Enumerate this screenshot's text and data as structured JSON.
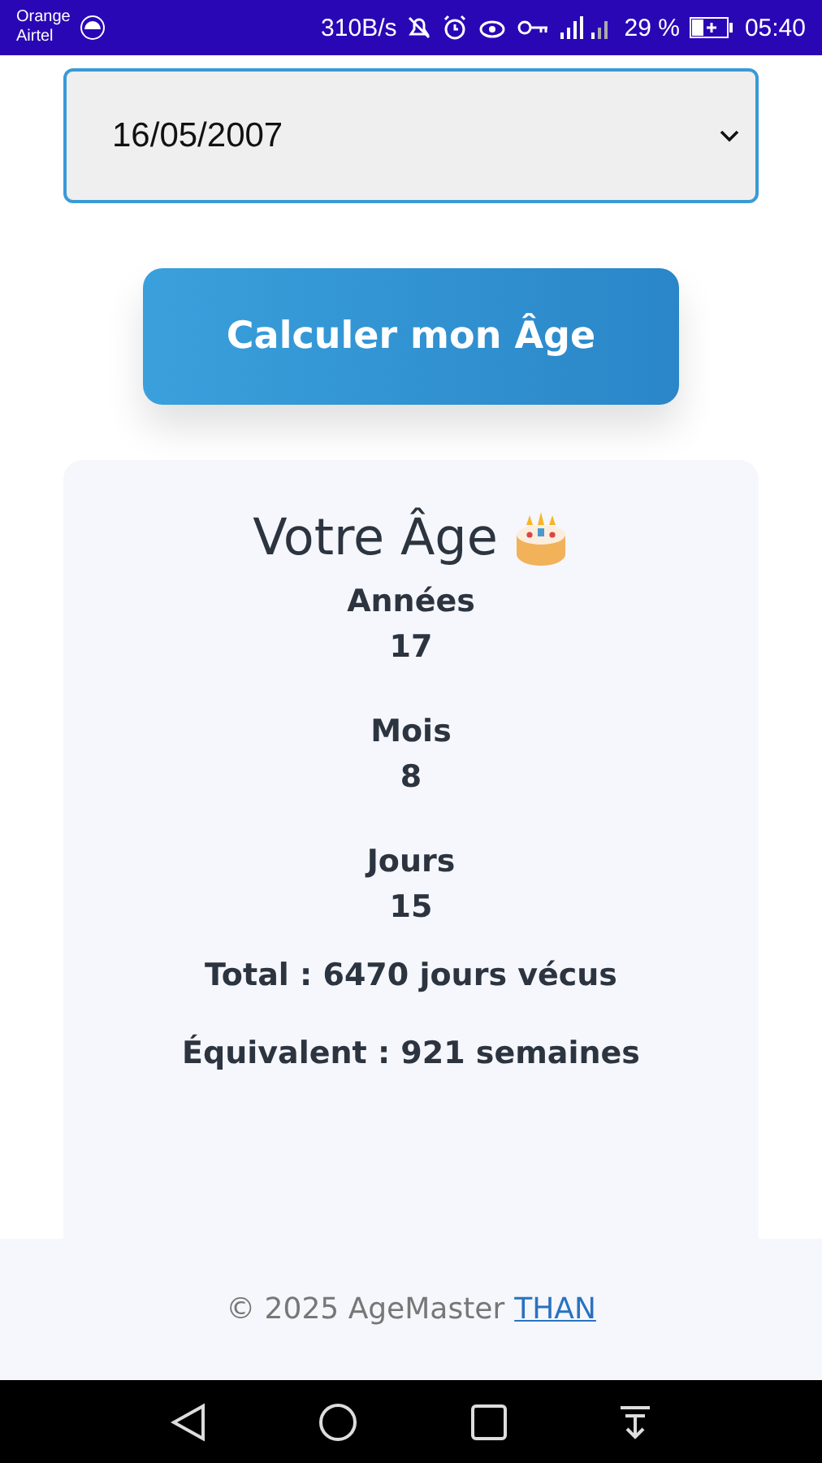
{
  "status_bar": {
    "carrier_line1": "Orange",
    "carrier_line2": "Airtel",
    "speed": "310B/s",
    "battery": "29 %",
    "time": "05:40"
  },
  "date_select": {
    "value": "16/05/2007"
  },
  "calculate_button": "Calculer mon Âge",
  "result": {
    "title": "Votre Âge",
    "stats": [
      {
        "label": "Années",
        "value": "17"
      },
      {
        "label": "Mois",
        "value": "8"
      },
      {
        "label": "Jours",
        "value": "15"
      }
    ],
    "summary": [
      "Total : 6470 jours vécus",
      "Équivalent : 921 semaines"
    ]
  },
  "footer": {
    "text": "© 2025 AgeMaster",
    "link": "THAN"
  }
}
